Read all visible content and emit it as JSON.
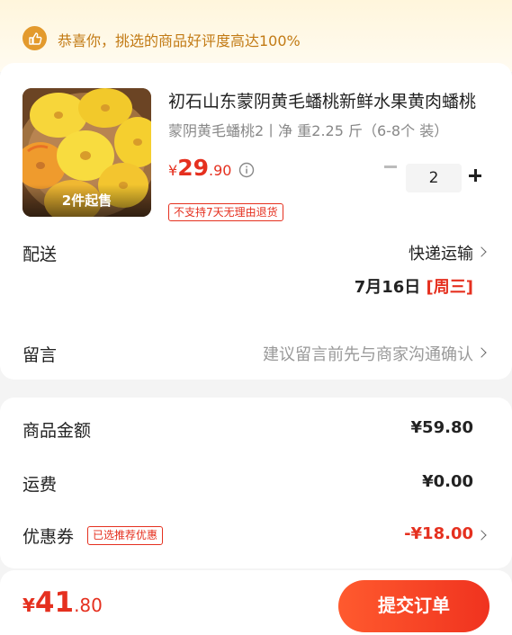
{
  "banner": {
    "text": "恭喜你，挑选的商品好评度高达100%",
    "icon": "thumbs-up-icon"
  },
  "product": {
    "title": "初石山东蒙阴黄毛蟠桃新鲜水果黄肉蟠桃",
    "spec": "蒙阴黄毛蟠桃2丨净 重2.25 斤（6-8个 装）",
    "min_badge": "2件起售",
    "price_currency": "¥",
    "price_int": "29",
    "price_dec": ".90",
    "quantity": "2",
    "return_policy": "不支持7天无理由退货"
  },
  "delivery": {
    "label": "配送",
    "method": "快递运输",
    "date": "7月16日",
    "weekday": "[周三]"
  },
  "message": {
    "label": "留言",
    "placeholder": "建议留言前先与商家沟通确认"
  },
  "summary": {
    "goods_label": "商品金额",
    "goods_value": "¥59.80",
    "shipping_label": "运费",
    "shipping_value": "¥0.00",
    "coupon_label": "优惠券",
    "coupon_tag": "已选推荐优惠",
    "coupon_value": "-¥18.00"
  },
  "footer": {
    "total_currency": "¥",
    "total_int": "41",
    "total_dec": ".80",
    "submit_label": "提交订单"
  },
  "colors": {
    "accent": "#e5301f",
    "banner_text": "#c27a14",
    "banner_icon": "#e39a2d"
  }
}
